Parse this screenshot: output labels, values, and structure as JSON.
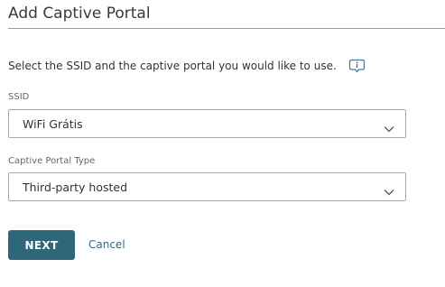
{
  "page": {
    "title": "Add Captive Portal"
  },
  "instruction": {
    "text": "Select the SSID and the captive portal you would like to use.",
    "info_icon": "info-icon"
  },
  "ssid": {
    "label": "SSID",
    "selected_value": "WiFi Grátis"
  },
  "portal_type": {
    "label": "Captive Portal Type",
    "selected_value": "Third-party hosted"
  },
  "actions": {
    "next_label": "NEXT",
    "cancel_label": "Cancel"
  },
  "colors": {
    "primary_button": "#2f6779",
    "link": "#2e6b80",
    "info_icon": "#3b7a8f"
  }
}
